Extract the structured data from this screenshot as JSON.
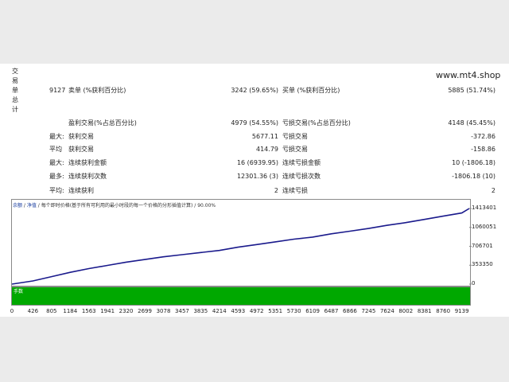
{
  "side_label": [
    "交",
    "易",
    "单",
    "总",
    "计"
  ],
  "site": "www.mt4.shop",
  "stats": {
    "total_trades": "9127",
    "short_label": "卖单 (%获利百分比)",
    "short_value": "3242 (59.65%)",
    "long_label": "买单 (%获利百分比)",
    "long_value": "5885 (51.74%)",
    "profit_trades_label": "盈利交易(%占总百分比)",
    "profit_trades_value": "4979 (54.55%)",
    "loss_trades_label": "亏损交易(%占总百分比)",
    "loss_trades_value": "4148 (45.45%)",
    "largest_label": "最大:",
    "largest_profit_label": "获利交易",
    "largest_profit_value": "5677.11",
    "largest_loss_label": "亏损交易",
    "largest_loss_value": "-372.86",
    "average_label": "平均",
    "average_profit_label": "获利交易",
    "average_profit_value": "414.79",
    "average_loss_label": "亏损交易",
    "average_loss_value": "-158.86",
    "max_label": "最大:",
    "max_consec_wins_label": "连续获利金额",
    "max_consec_wins_value": "16 (6939.95)",
    "max_consec_losses_label": "连续亏损金额",
    "max_consec_losses_value": "10 (-1806.18)",
    "maximal_label": "最多:",
    "maximal_consec_profit_label": "连续获利次数",
    "maximal_consec_profit_value": "12301.36 (3)",
    "maximal_consec_loss_label": "连续亏损次数",
    "maximal_consec_loss_value": "-1806.18 (10)",
    "avg_label": "平均:",
    "avg_consec_wins_label": "连续获利",
    "avg_consec_wins_value": "2",
    "avg_consec_losses_label": "连续亏损",
    "avg_consec_losses_value": "2"
  },
  "chart_header": {
    "link1": "余额",
    "sep1": " / ",
    "link2": "净值",
    "rest": " / 每个即时价格(基于所有可利用的最小时段的每一个价格的分形插值计算) / 90.00%"
  },
  "volume_label": "手数",
  "colors": {
    "balance_line": "#1a1a8c",
    "volume_fill": "#00a800"
  },
  "chart_data": {
    "type": "line",
    "x": [
      0,
      426,
      805,
      1184,
      1563,
      1941,
      2320,
      2699,
      3078,
      3457,
      3835,
      4214,
      4593,
      4972,
      5351,
      5730,
      6109,
      6487,
      6866,
      7245,
      7624,
      8002,
      8381,
      8760,
      9139,
      9290
    ],
    "series": [
      {
        "values": [
          0,
          60000,
          140000,
          220000,
          290000,
          350000,
          410000,
          460000,
          510000,
          550000,
          590000,
          630000,
          690000,
          740000,
          790000,
          840000,
          880000,
          940000,
          990000,
          1040000,
          1100000,
          1150000,
          1210000,
          1270000,
          1330000,
          1413401
        ]
      }
    ],
    "ylim": [
      0,
      1413401
    ],
    "yticks": [
      "1413401",
      "1060051",
      "706701",
      "353350",
      "0"
    ],
    "xticks": [
      "0",
      "426",
      "805",
      "1184",
      "1563",
      "1941",
      "2320",
      "2699",
      "3078",
      "3457",
      "3835",
      "4214",
      "4593",
      "4972",
      "5351",
      "5730",
      "6109",
      "6487",
      "6866",
      "7245",
      "7624",
      "8002",
      "8381",
      "8760",
      "9139"
    ],
    "grid": false
  }
}
